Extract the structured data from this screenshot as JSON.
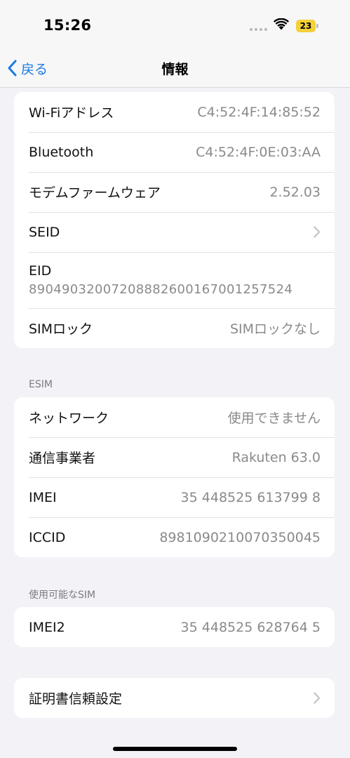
{
  "status_bar": {
    "time": "15:26",
    "battery_level": "23"
  },
  "nav": {
    "back_label": "戻る",
    "title": "情報"
  },
  "group1": {
    "rows": [
      {
        "label": "Wi-Fiアドレス",
        "value": "C4:52:4F:14:85:52"
      },
      {
        "label": "Bluetooth",
        "value": "C4:52:4F:0E:03:AA"
      },
      {
        "label": "モデムファームウェア",
        "value": "2.52.03"
      },
      {
        "label": "SEID"
      },
      {
        "label": "EID",
        "value": "89049032007208882600167001257524"
      },
      {
        "label": "SIMロック",
        "value": "SIMロックなし"
      }
    ]
  },
  "esim": {
    "header": "ESIM",
    "rows": [
      {
        "label": "ネットワーク",
        "value": "使用できません"
      },
      {
        "label": "通信事業者",
        "value": "Rakuten 63.0"
      },
      {
        "label": "IMEI",
        "value": "35 448525 613799 8"
      },
      {
        "label": "ICCID",
        "value": "8981090210070350045"
      }
    ]
  },
  "available_sim": {
    "header": "使用可能なSIM",
    "rows": [
      {
        "label": "IMEI2",
        "value": "35 448525 628764 5"
      }
    ]
  },
  "certificates": {
    "label": "証明書信頼設定"
  },
  "colors": {
    "accent": "#1a7ae6",
    "battery": "#f4d13a",
    "background": "#f2f2f7"
  },
  "icons": [
    "wifi-icon",
    "battery-icon",
    "chevron-left-icon",
    "chevron-right-icon"
  ]
}
